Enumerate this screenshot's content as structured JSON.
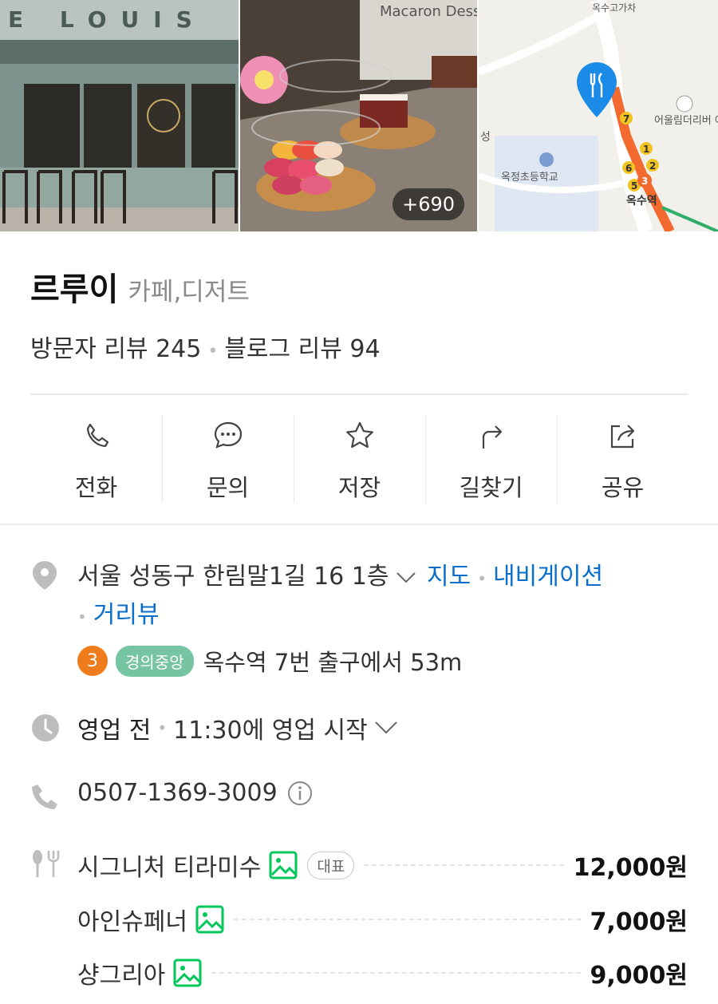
{
  "photos": {
    "items": [
      {
        "label": "storefront-photo",
        "sign_text": "E LOUIS"
      },
      {
        "label": "dessert-display-photo",
        "sign_text": "Macaron Dessert"
      },
      {
        "label": "location-map"
      }
    ],
    "more_count": "+690",
    "map_labels": [
      "옥정초등학교",
      "어울림더리버 아파트",
      "옥수역",
      "옥수고가차",
      "성"
    ]
  },
  "place": {
    "name": "르루이",
    "category": "카페,디저트",
    "visitor_reviews": "방문자 리뷰 245",
    "blog_reviews": "블로그 리뷰 94"
  },
  "actions": [
    {
      "label": "전화",
      "icon": "phone-icon"
    },
    {
      "label": "문의",
      "icon": "chat-icon"
    },
    {
      "label": "저장",
      "icon": "star-icon"
    },
    {
      "label": "길찾기",
      "icon": "directions-icon"
    },
    {
      "label": "공유",
      "icon": "share-icon"
    }
  ],
  "address": {
    "text": "서울 성동구 한림말1길 16 1층",
    "links": {
      "map": "지도",
      "navigation": "내비게이션",
      "streetview": "거리뷰"
    }
  },
  "subway": {
    "line_number": "3",
    "line_number_color": "#ef7c1c",
    "line_name": "경의중앙",
    "line_name_color": "#77c4a3",
    "directions": "옥수역 7번 출구에서 53m"
  },
  "hours": {
    "status": "영업 전",
    "detail": "11:30에 영업 시작"
  },
  "phone": {
    "number": "0507-1369-3009"
  },
  "menu": [
    {
      "name": "시그니처 티라미수",
      "price": "12,000원",
      "badge": "대표"
    },
    {
      "name": "아인슈페너",
      "price": "7,000원"
    },
    {
      "name": "샹그리아",
      "price": "9,000원"
    }
  ],
  "colors": {
    "link": "#0a6fcc",
    "accent_photo_icon": "#03c75a",
    "map_pin": "#1a8ce8"
  }
}
